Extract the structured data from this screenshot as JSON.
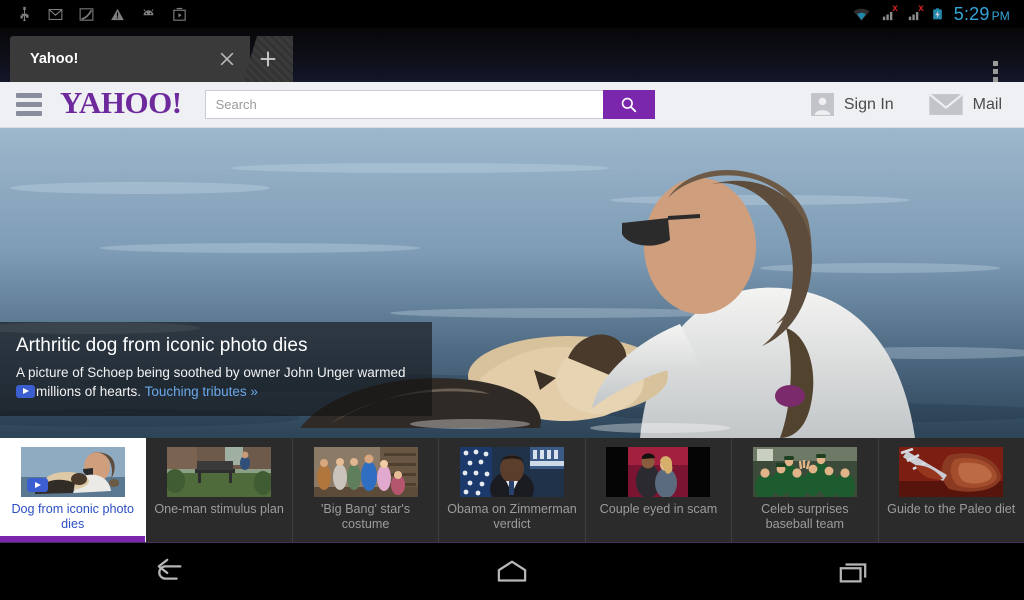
{
  "status_bar": {
    "notification_icons": [
      {
        "name": "usb-icon",
        "label": "USB"
      },
      {
        "name": "gmail-icon",
        "label": "Gmail"
      },
      {
        "name": "swype-icon",
        "label": "Swype keyboard"
      },
      {
        "name": "warning-icon",
        "label": "Warning"
      },
      {
        "name": "android-icon",
        "label": "Android system"
      },
      {
        "name": "play-store-icon",
        "label": "Play Store"
      }
    ],
    "wifi": "wifi-icon",
    "signal_1": "signal-no-service-icon",
    "signal_2": "signal-no-service-icon",
    "signal_x": "x",
    "battery": "battery-charging-icon",
    "time": "5:29",
    "meridiem": "PM",
    "clock_color": "#35a5d8"
  },
  "browser": {
    "tab": {
      "title": "Yahoo!",
      "close_icon": "close-icon"
    },
    "new_tab_icon": "plus-icon",
    "overflow_icon": "more-vertical-icon"
  },
  "yahoo_header": {
    "menu_icon": "hamburger-menu-icon",
    "logo": "YAHOO!",
    "logo_color": "#6e2a9c",
    "search": {
      "placeholder": "Search",
      "value": "",
      "button_icon": "search-icon",
      "button_color": "#7b27ad"
    },
    "sign_in": {
      "label": "Sign In",
      "icon": "user-avatar-icon"
    },
    "mail": {
      "label": "Mail",
      "icon": "envelope-icon"
    }
  },
  "hero": {
    "image_alt": "Man floating in a lake cradling an elderly dog",
    "title": "Arthritic dog from iconic photo dies",
    "subtitle_part1": "A picture of Schoep being soothed by owner John Unger warmed",
    "subtitle_part2": "millions of hearts.",
    "link_label": "Touching tributes »",
    "play_icon": "video-play-icon"
  },
  "thumbnails": [
    {
      "label": "Dog from iconic photo dies",
      "active": true,
      "has_video": true,
      "image_alt": "Man in water with dog",
      "scene": "dog"
    },
    {
      "label": "One-man stimulus plan",
      "active": false,
      "has_video": false,
      "image_alt": "Man sitting on garden bench",
      "scene": "bench"
    },
    {
      "label": "'Big Bang' star's costume",
      "active": false,
      "has_video": false,
      "image_alt": "Television sitcom cast on set",
      "scene": "cast"
    },
    {
      "label": "Obama on Zimmerman verdict",
      "active": false,
      "has_video": false,
      "image_alt": "President Obama at White House podium",
      "scene": "obama"
    },
    {
      "label": "Couple eyed in scam",
      "active": false,
      "has_video": false,
      "image_alt": "Couple photographed at a party",
      "scene": "couple"
    },
    {
      "label": "Celeb surprises baseball team",
      "active": false,
      "has_video": false,
      "image_alt": "Team in green jerseys cheering",
      "scene": "team"
    },
    {
      "label": "Guide to the Paleo diet",
      "active": false,
      "has_video": false,
      "image_alt": "Sliced steak on a fork",
      "scene": "steak"
    }
  ],
  "android_nav": {
    "back": "back-icon",
    "home": "home-icon",
    "recents": "recent-apps-icon"
  },
  "theme": {
    "accent_purple": "#7b27ad",
    "header_bg": "#eff0f4",
    "strip_bg": "#2b2b2b",
    "link_blue": "#2b4fc4"
  }
}
